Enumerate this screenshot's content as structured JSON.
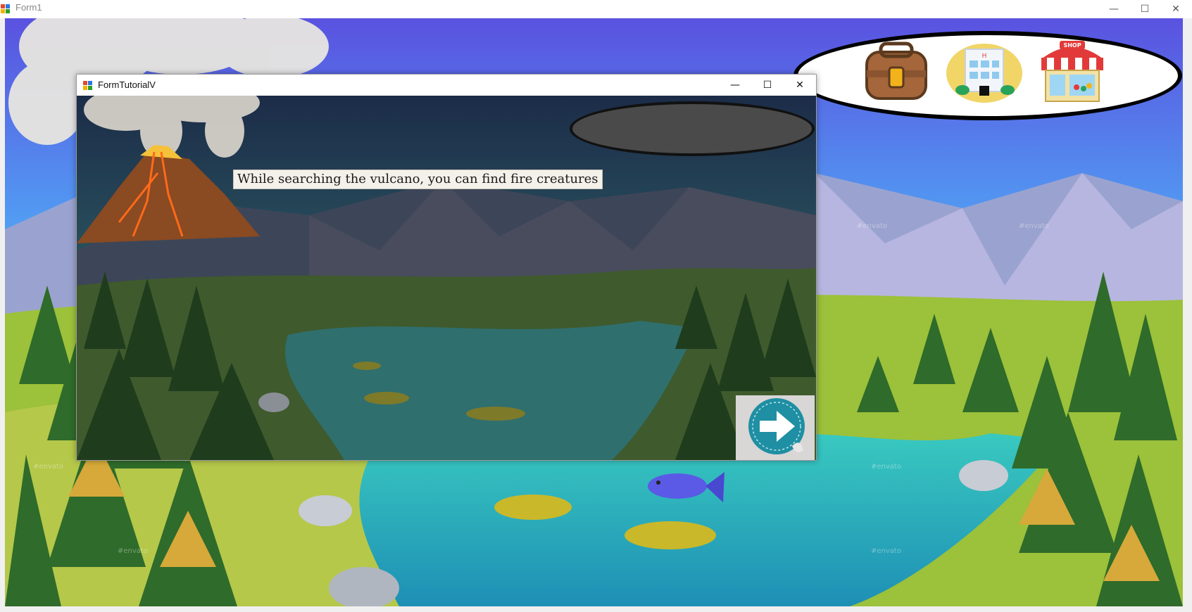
{
  "main_window": {
    "title": "Form1",
    "minimize": "—",
    "maximize": "☐",
    "close": "✕"
  },
  "child_window": {
    "title": "FormTutorialV",
    "minimize": "—",
    "maximize": "☐",
    "close": "✕"
  },
  "tutorial": {
    "message": "While searching the vulcano, you can find fire creatures"
  },
  "toolbar": {
    "items": [
      {
        "name": "backpack-icon"
      },
      {
        "name": "hospital-icon"
      },
      {
        "name": "shop-icon",
        "sign": "SHOP"
      }
    ]
  },
  "watermark": "#envato",
  "colors": {
    "sky_top": "#5a5ae0",
    "sky_bottom": "#3fd4ff",
    "grass": "#9cc13a",
    "water": "#2bb9b5",
    "next_button": "#1f8fa3"
  }
}
